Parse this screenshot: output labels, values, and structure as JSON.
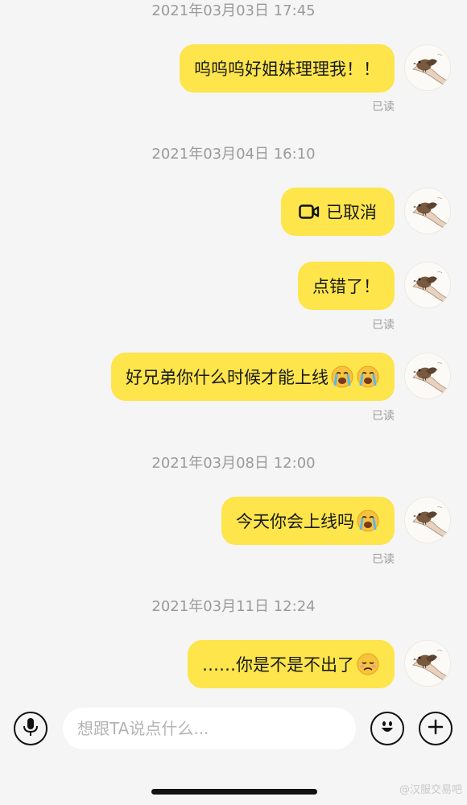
{
  "messages": [
    {
      "time": "2021年03月03日 17:45",
      "text": "呜呜呜好姐妹理理我！！",
      "read": "已读"
    },
    {
      "time": "2021年03月04日 16:10",
      "text": "已取消",
      "icon": "video-call-icon"
    },
    {
      "text": "点错了！",
      "read": "已读"
    },
    {
      "text": "好兄弟你什么时候才能上线",
      "emoji": [
        "loudly-crying-emoji",
        "loudly-crying-emoji"
      ],
      "read": "已读"
    },
    {
      "time": "2021年03月08日 12:00",
      "text": "今天你会上线吗",
      "emoji": [
        "loudly-crying-emoji"
      ],
      "read": "已读"
    },
    {
      "time": "2021年03月11日 12:24",
      "text": "……你是不是不出了",
      "emoji": [
        "sad-emoji"
      ]
    }
  ],
  "input": {
    "placeholder": "想跟TA说点什么..."
  },
  "colors": {
    "bubble": "#fde54b",
    "background": "#f5f5f5",
    "meta_text": "#9a9a9a"
  },
  "icons": [
    "microphone-icon",
    "emoji-face-icon",
    "add-icon"
  ],
  "watermark": "@汉服交易吧"
}
